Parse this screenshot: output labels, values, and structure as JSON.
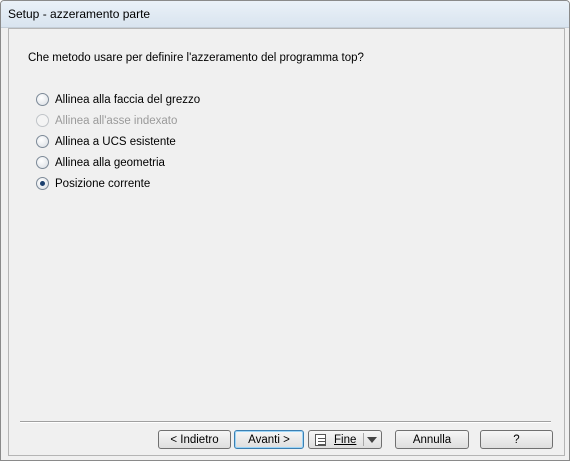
{
  "window": {
    "title": "Setup - azzeramento parte"
  },
  "question": "Che metodo usare per definire l'azzeramento del programma top?",
  "options": [
    {
      "label": "Allinea alla faccia del grezzo",
      "checked": false,
      "enabled": true
    },
    {
      "label": "Allinea all'asse indexato",
      "checked": false,
      "enabled": false
    },
    {
      "label": "Allinea a UCS esistente",
      "checked": false,
      "enabled": true
    },
    {
      "label": "Allinea alla geometria",
      "checked": false,
      "enabled": true
    },
    {
      "label": "Posizione corrente",
      "checked": true,
      "enabled": true
    }
  ],
  "buttons": {
    "back": "< Indietro",
    "next": "Avanti >",
    "finish": "Fine",
    "cancel": "Annulla",
    "help": "?"
  },
  "icons": {
    "finish": "document-list-icon",
    "finish_menu": "chevron-down-icon"
  }
}
